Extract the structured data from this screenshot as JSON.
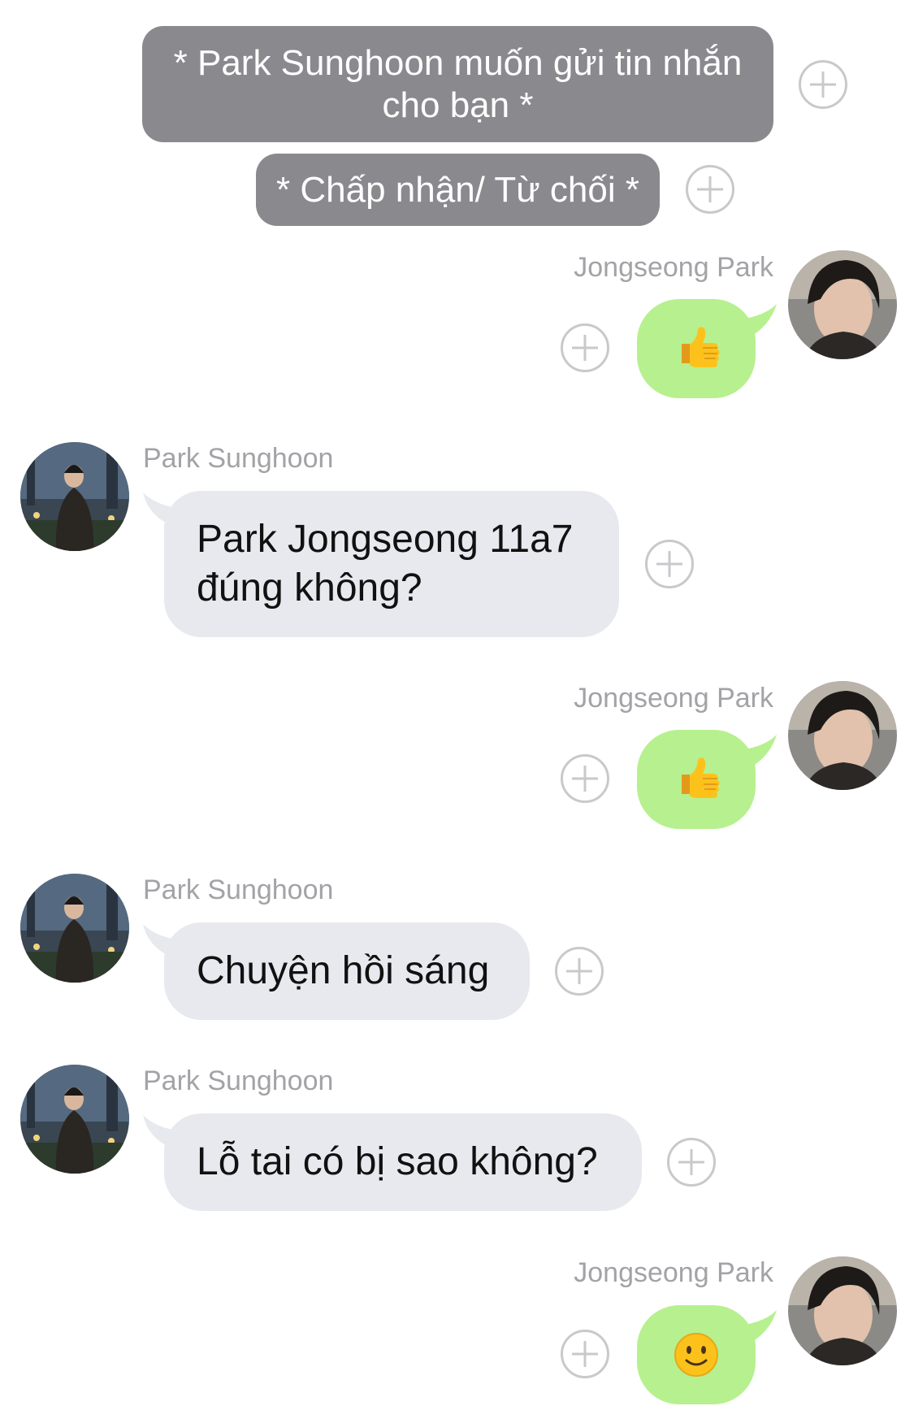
{
  "system_notices": [
    {
      "text": "* Park Sunghoon muốn gửi tin nhắn cho bạn *"
    },
    {
      "text": "* Chấp nhận/ Từ chối *"
    }
  ],
  "messages": [
    {
      "sender": "Jongseong Park",
      "direction": "outgoing",
      "content": "thumbs-up-emoji"
    },
    {
      "sender": "Park Sunghoon",
      "direction": "incoming",
      "text": "Park Jongseong 11a7 đúng không?"
    },
    {
      "sender": "Jongseong Park",
      "direction": "outgoing",
      "content": "thumbs-up-emoji"
    },
    {
      "sender": "Park Sunghoon",
      "direction": "incoming",
      "text": "Chuyện hồi sáng"
    },
    {
      "sender": "Park Sunghoon",
      "direction": "incoming",
      "text": "Lỗ tai có bị sao không?"
    },
    {
      "sender": "Jongseong Park",
      "direction": "outgoing",
      "content": "slightly-smiling-face-emoji"
    }
  ],
  "icons": {
    "add": "plus-circle-icon",
    "thumbs_up": "thumbs-up-emoji",
    "smile": "slightly-smiling-face-emoji"
  },
  "colors": {
    "system_bubble": "#8a898d",
    "incoming_bubble": "#e8e9ee",
    "outgoing_bubble": "#b7f08f",
    "sender_name": "#a3a3a7",
    "plus_icon": "#c9c9cc"
  }
}
